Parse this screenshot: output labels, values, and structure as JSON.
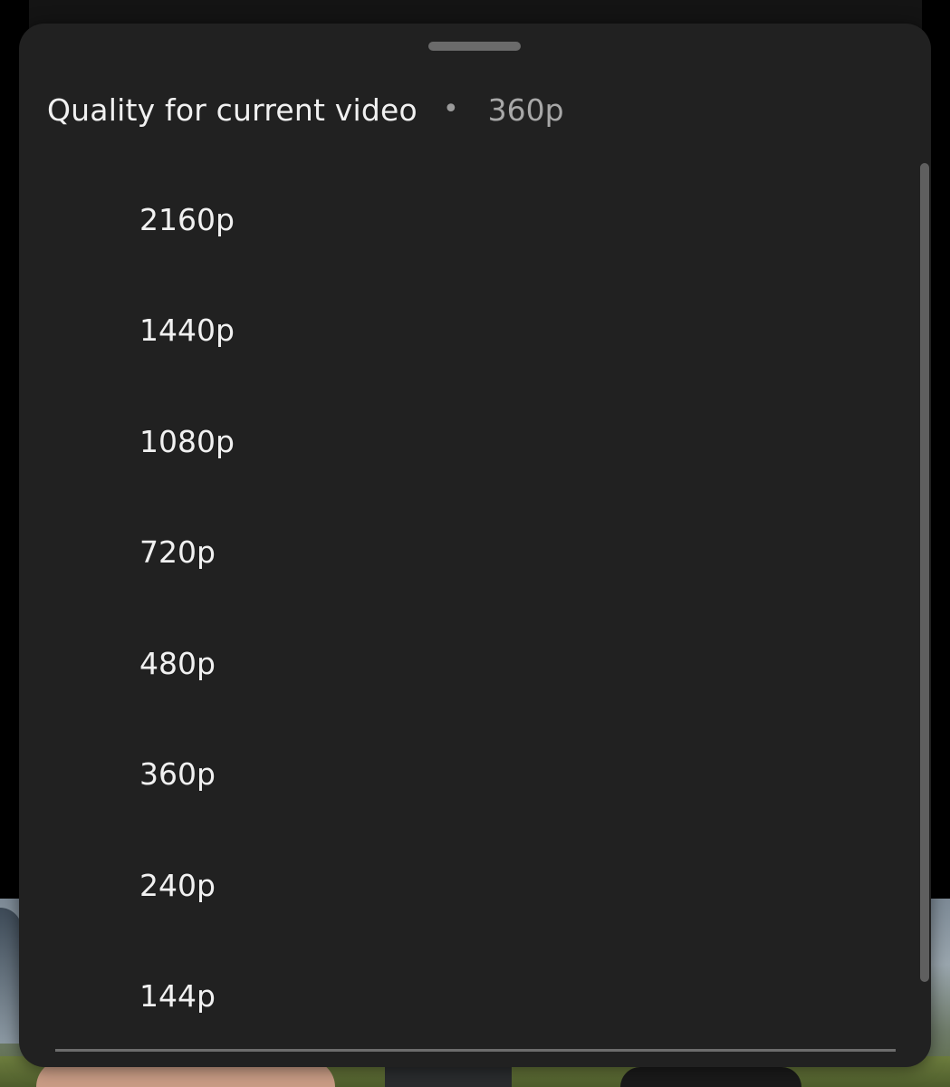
{
  "sheet": {
    "header": {
      "title": "Quality for current video",
      "separator": "•",
      "current_quality": "360p"
    },
    "options": [
      {
        "label": "2160p"
      },
      {
        "label": "1440p"
      },
      {
        "label": "1080p"
      },
      {
        "label": "720p"
      },
      {
        "label": "480p"
      },
      {
        "label": "360p"
      },
      {
        "label": "240p"
      },
      {
        "label": "144p"
      }
    ]
  },
  "icons": {
    "drag_handle": "drag-handle-bar",
    "separator": "bullet-dot"
  },
  "colors": {
    "sheet_background": "#212121",
    "primary_text": "#f1f1f1",
    "secondary_text": "#a8a8a8",
    "handle": "#6b6b6b",
    "scrollbar": "#5f5f5f"
  }
}
